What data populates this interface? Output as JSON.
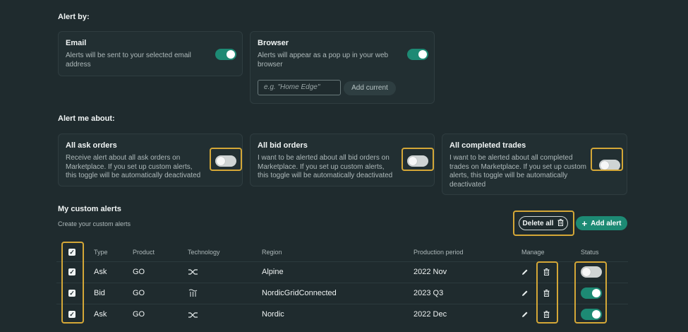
{
  "alert_by": {
    "title": "Alert by:",
    "email": {
      "title": "Email",
      "desc_lines": [
        "Alerts will be sent to your selected email",
        "address"
      ],
      "toggle_on": true
    },
    "browser": {
      "title": "Browser",
      "desc_lines": [
        "Alerts will appear as a pop up in your web",
        "browser"
      ],
      "toggle_on": true,
      "input_placeholder": "e.g. \"Home Edge\"",
      "add_current_label": "Add current"
    }
  },
  "alert_me_about": {
    "title": "Alert me about:",
    "ask": {
      "title": "All ask orders",
      "desc_lines": [
        "Receive alert about all ask orders on",
        "Marketplace. If you set up custom alerts,",
        "this toggle will be automatically deactivated"
      ],
      "toggle_on": false
    },
    "bid": {
      "title": "All bid orders",
      "desc_lines": [
        "I want to be alerted about all bid orders on",
        "Marketplace. If you set up custom alerts,",
        "this toggle will be automatically deactivated"
      ],
      "toggle_on": false
    },
    "trades": {
      "title": "All completed trades",
      "desc_lines": [
        "I want to be alerted about all completed",
        "trades on Marketplace. If you set up custom",
        "alerts, this toggle will be automatically",
        "deactivated"
      ],
      "toggle_on": false
    }
  },
  "custom_alerts": {
    "title": "My custom alerts",
    "subtitle": "Create your custom alerts",
    "delete_all_label": "Delete all",
    "add_alert_label": "Add alert",
    "columns": {
      "type": "Type",
      "product": "Product",
      "technology": "Technology",
      "region": "Region",
      "period": "Production period",
      "manage": "Manage",
      "status": "Status"
    },
    "rows": [
      {
        "type": "Ask",
        "product": "GO",
        "technology_icon": "shuffle-icon",
        "region": "Alpine",
        "period": "2022 Nov",
        "checked": true,
        "status_on": false
      },
      {
        "type": "Bid",
        "product": "GO",
        "technology_icon": "hydro-icon",
        "region": "NordicGridConnected",
        "period": "2023 Q3",
        "checked": true,
        "status_on": true
      },
      {
        "type": "Ask",
        "product": "GO",
        "technology_icon": "shuffle-icon",
        "region": "Nordic",
        "period": "2022 Dec",
        "checked": true,
        "status_on": true
      }
    ]
  },
  "colors": {
    "background": "#1f2b2e",
    "accent": "#1d8a74",
    "highlight": "#d4a737"
  }
}
